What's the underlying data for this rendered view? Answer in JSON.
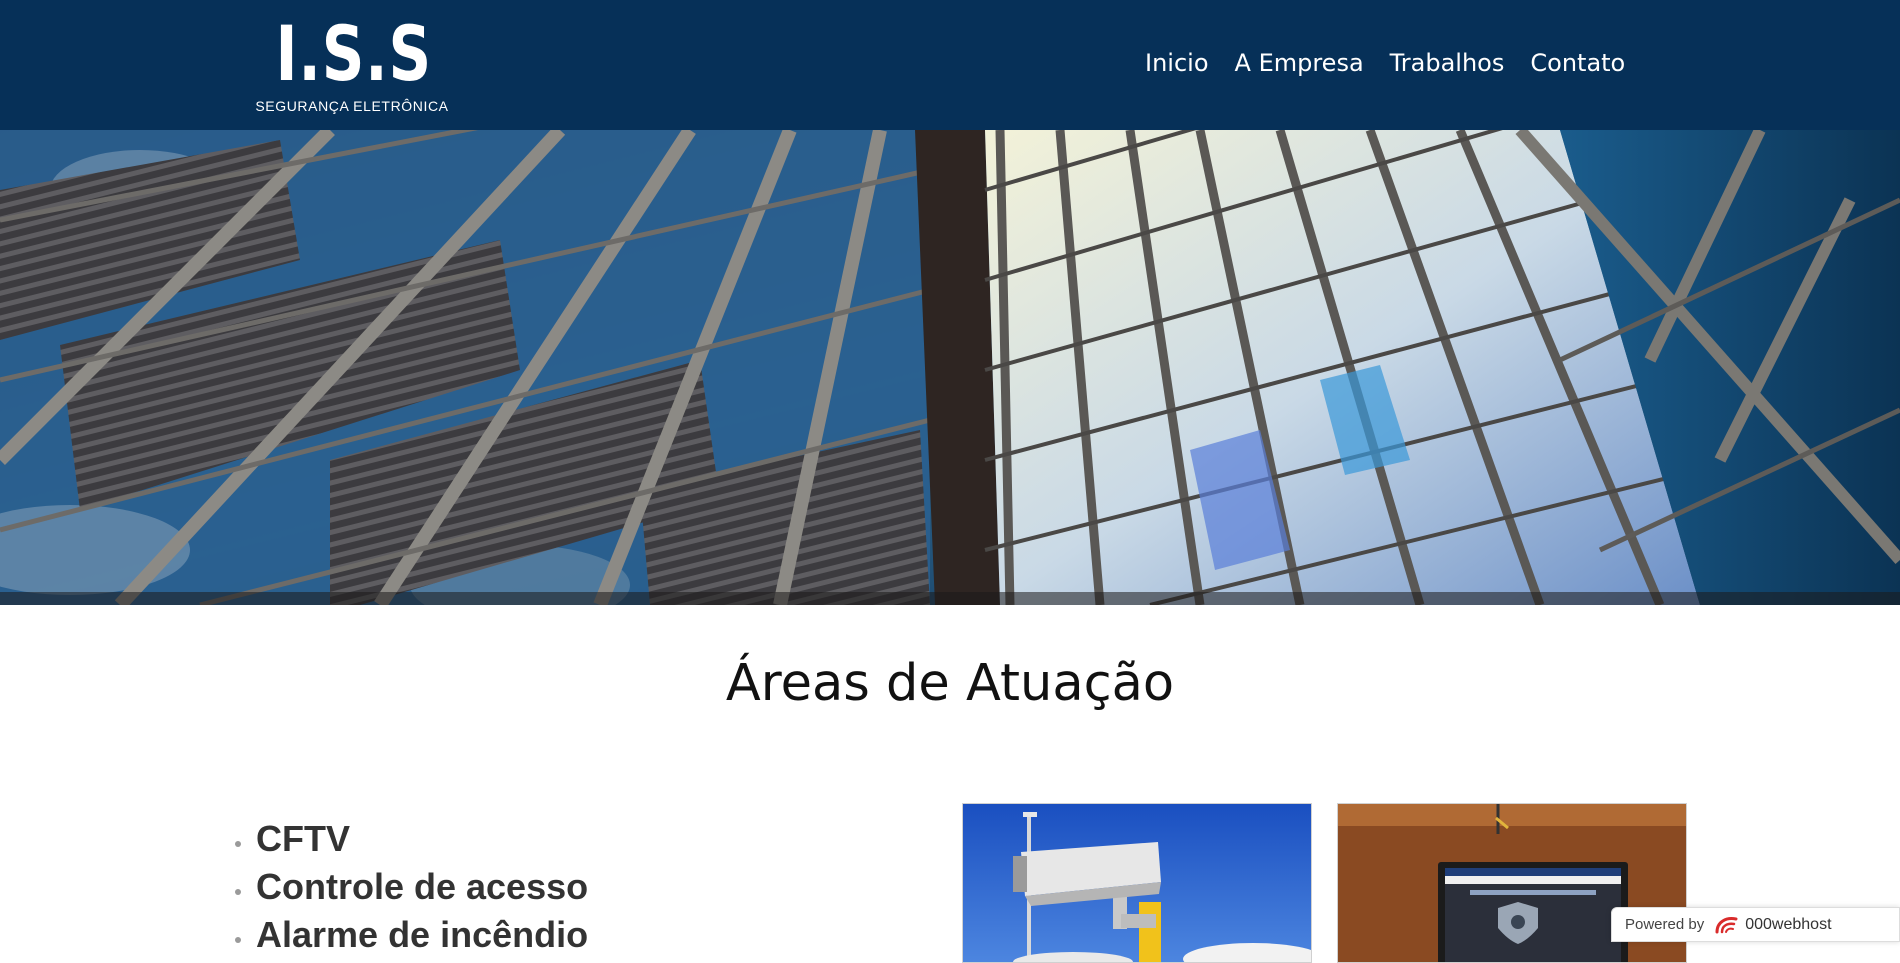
{
  "header": {
    "logo_mark": "I.S.S",
    "logo_subtitle": "SEGURANÇA ELETRÔNICA",
    "nav": [
      {
        "label": "Inicio"
      },
      {
        "label": "A Empresa"
      },
      {
        "label": "Trabalhos"
      },
      {
        "label": "Contato"
      }
    ]
  },
  "hero": {
    "image": "glass-building-facade"
  },
  "section": {
    "title": "Áreas de Atuação",
    "services": [
      "CFTV",
      "Controle de acesso",
      "Alarme de incêndio"
    ],
    "thumbnails": [
      "security-camera-photo",
      "access-control-panel-photo"
    ]
  },
  "badge": {
    "prefix": "Powered by",
    "brand": "000webhost",
    "icon": "webhost-swirl-icon"
  },
  "colors": {
    "header_bg": "#063058",
    "nav_text": "#ffffff",
    "title_text": "#111111",
    "list_text": "#333333"
  }
}
